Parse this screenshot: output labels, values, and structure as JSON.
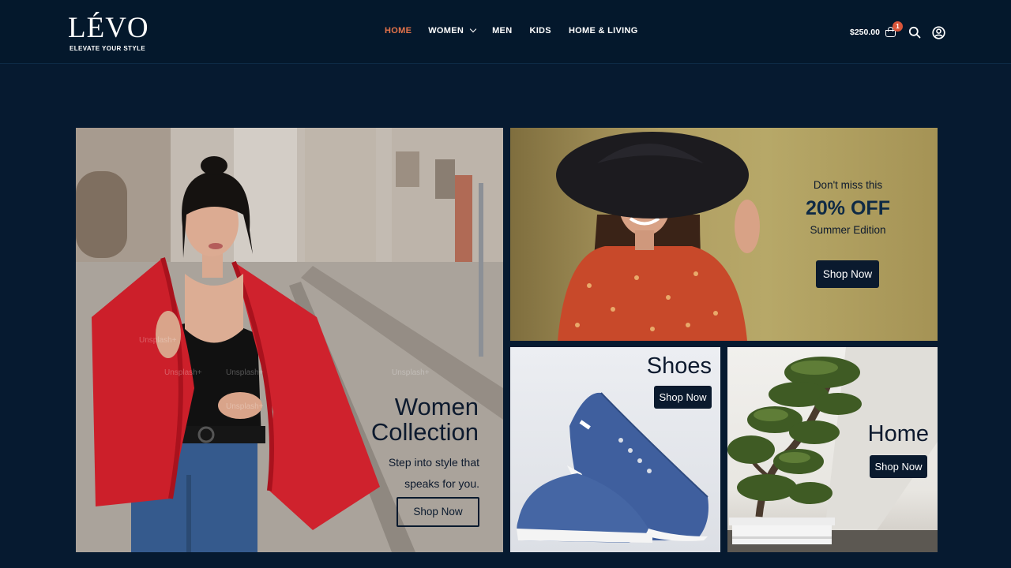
{
  "brand": {
    "name": "LÉVO",
    "tagline": "ELEVATE YOUR STYLE"
  },
  "nav": [
    {
      "label": "HOME",
      "active": true
    },
    {
      "label": "WOMEN",
      "dropdown": true
    },
    {
      "label": "MEN"
    },
    {
      "label": "KIDS"
    },
    {
      "label": "HOME & LIVING"
    }
  ],
  "header": {
    "cart_total": "$250.00",
    "cart_count": "1",
    "icons": [
      "cart-icon",
      "search-icon",
      "account-icon"
    ]
  },
  "colors": {
    "background": "#061a30",
    "header": "#04182c",
    "accent": "#e4734a",
    "button": "#0a1a2e",
    "badge": "#d9553a"
  },
  "tiles": {
    "women": {
      "title_line1": "Women",
      "title_line2": "Collection",
      "subtitle_line1": "Step into style that",
      "subtitle_line2": "speaks for you.",
      "button": "Shop Now"
    },
    "summer": {
      "pretitle": "Don't miss this",
      "headline": "20% OFF",
      "subtitle": "Summer Edition",
      "button": "Shop Now"
    },
    "shoes": {
      "title": "Shoes",
      "button": "Shop Now"
    },
    "home": {
      "title": "Home",
      "button": "Shop Now"
    }
  },
  "watermark": "Unsplash+"
}
